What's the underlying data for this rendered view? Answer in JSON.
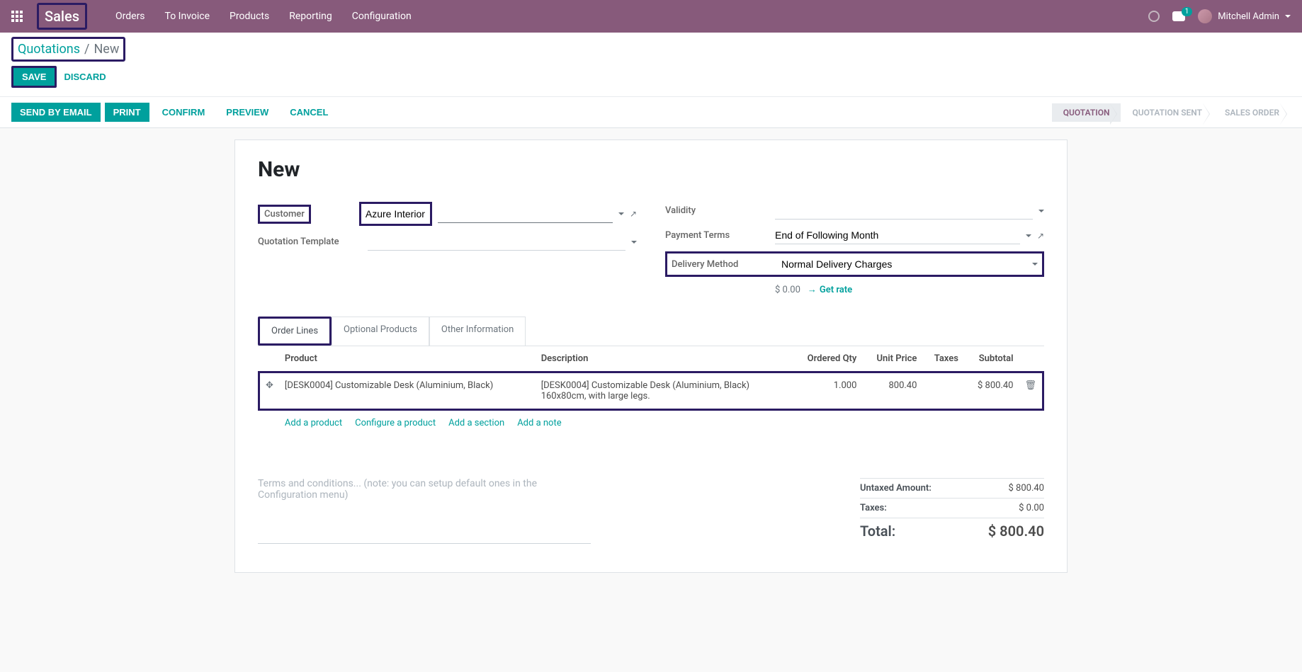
{
  "topnav": {
    "brand": "Sales",
    "menu": [
      "Orders",
      "To Invoice",
      "Products",
      "Reporting",
      "Configuration"
    ],
    "chat_badge": "1",
    "user": "Mitchell Admin"
  },
  "breadcrumb": {
    "link": "Quotations",
    "sep": "/",
    "current": "New"
  },
  "buttons": {
    "save": "SAVE",
    "discard": "DISCARD"
  },
  "actions": {
    "send_email": "SEND BY EMAIL",
    "print": "PRINT",
    "confirm": "CONFIRM",
    "preview": "PREVIEW",
    "cancel": "CANCEL"
  },
  "status": {
    "quotation": "QUOTATION",
    "sent": "QUOTATION SENT",
    "order": "SALES ORDER"
  },
  "form": {
    "title": "New",
    "labels": {
      "customer": "Customer",
      "quotation_template": "Quotation Template",
      "validity": "Validity",
      "payment_terms": "Payment Terms",
      "delivery_method": "Delivery Method"
    },
    "values": {
      "customer": "Azure Interior",
      "quotation_template": "",
      "validity": "",
      "payment_terms": "End of Following Month",
      "delivery_method": "Normal Delivery Charges",
      "rate_value": "$ 0.00",
      "get_rate": "Get rate"
    }
  },
  "tabs": {
    "order_lines": "Order Lines",
    "optional": "Optional Products",
    "other": "Other Information"
  },
  "columns": {
    "product": "Product",
    "description": "Description",
    "qty": "Ordered Qty",
    "unit_price": "Unit Price",
    "taxes": "Taxes",
    "subtotal": "Subtotal"
  },
  "lines": [
    {
      "product": "[DESK0004] Customizable Desk (Aluminium, Black)",
      "description": "[DESK0004] Customizable Desk (Aluminium, Black)\n160x80cm, with large legs.",
      "qty": "1.000",
      "unit_price": "800.40",
      "taxes": "",
      "subtotal": "$ 800.40"
    }
  ],
  "add_links": {
    "product": "Add a product",
    "configure": "Configure a product",
    "section": "Add a section",
    "note": "Add a note"
  },
  "terms_placeholder": "Terms and conditions... (note: you can setup default ones in the Configuration menu)",
  "totals": {
    "untaxed_label": "Untaxed Amount:",
    "untaxed_value": "$ 800.40",
    "taxes_label": "Taxes:",
    "taxes_value": "$ 0.00",
    "total_label": "Total:",
    "total_value": "$ 800.40"
  }
}
